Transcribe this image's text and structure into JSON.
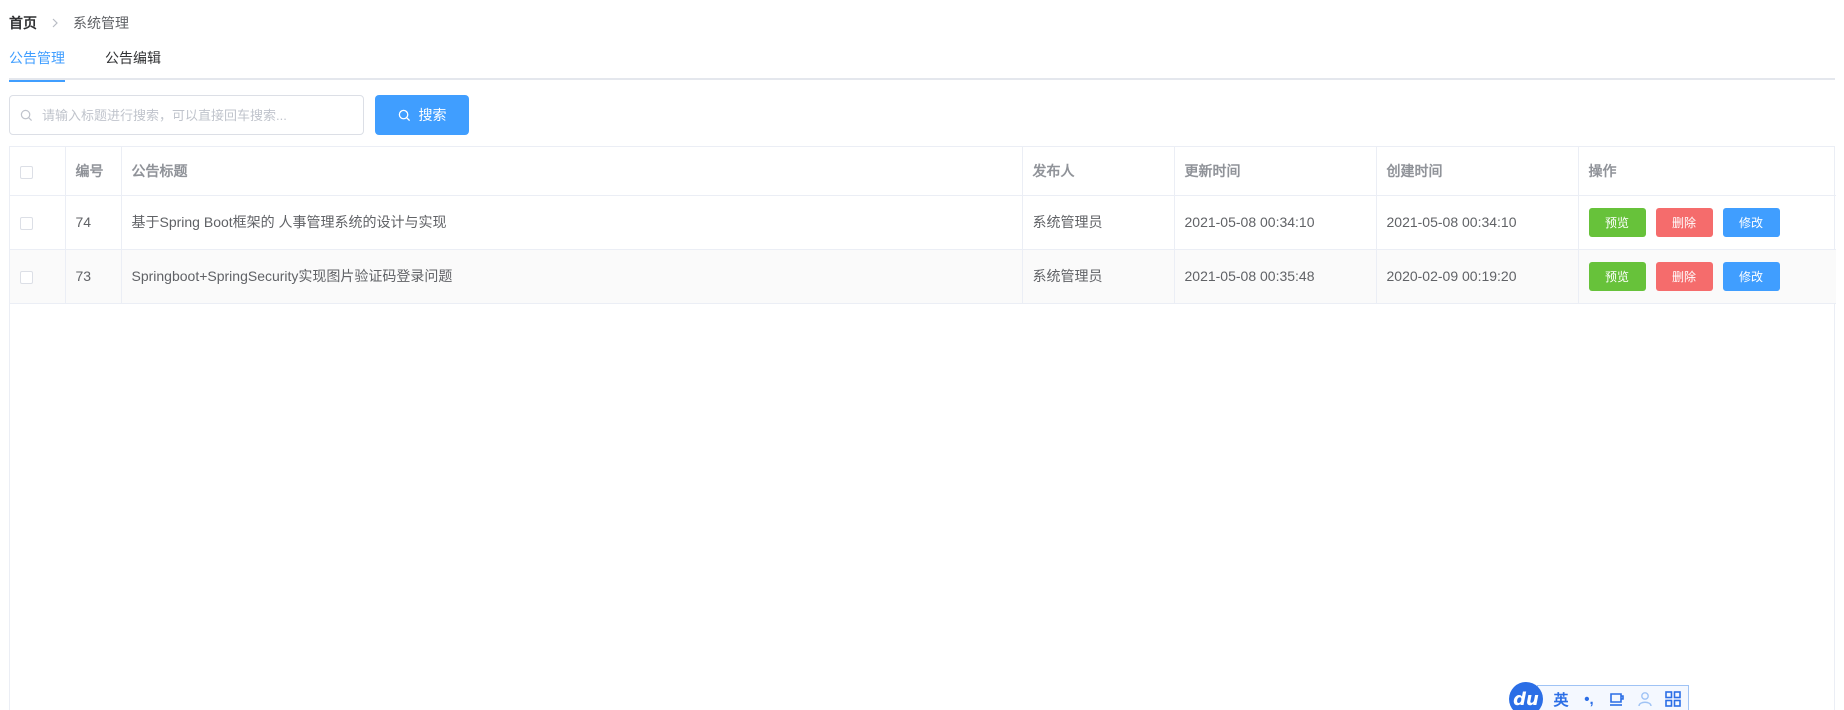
{
  "breadcrumb": {
    "home": "首页",
    "current": "系统管理"
  },
  "tabs": [
    {
      "label": "公告管理",
      "active": true
    },
    {
      "label": "公告编辑",
      "active": false
    }
  ],
  "search": {
    "placeholder": "请输入标题进行搜索，可以直接回车搜索...",
    "value": "",
    "button_label": "搜索"
  },
  "table": {
    "headers": {
      "id": "编号",
      "title": "公告标题",
      "publisher": "发布人",
      "updated": "更新时间",
      "created": "创建时间",
      "actions": "操作"
    },
    "rows": [
      {
        "id": "74",
        "title": "基于Spring Boot框架的 人事管理系统的设计与实现",
        "publisher": "系统管理员",
        "updated": "2021-05-08 00:34:10",
        "created": "2021-05-08 00:34:10"
      },
      {
        "id": "73",
        "title": "Springboot+SpringSecurity实现图片验证码登录问题",
        "publisher": "系统管理员",
        "updated": "2021-05-08 00:35:48",
        "created": "2020-02-09 00:19:20"
      }
    ],
    "action_labels": {
      "preview": "预览",
      "delete": "删除",
      "edit": "修改"
    }
  },
  "ime": {
    "logo": "du",
    "lang": "英",
    "punct": "•,",
    "icons": [
      "cup-icon",
      "user-icon",
      "grid-icon"
    ]
  },
  "colors": {
    "primary": "#409eff",
    "success": "#67c23a",
    "danger": "#f56c6c",
    "ime": "#2b6ee6"
  }
}
